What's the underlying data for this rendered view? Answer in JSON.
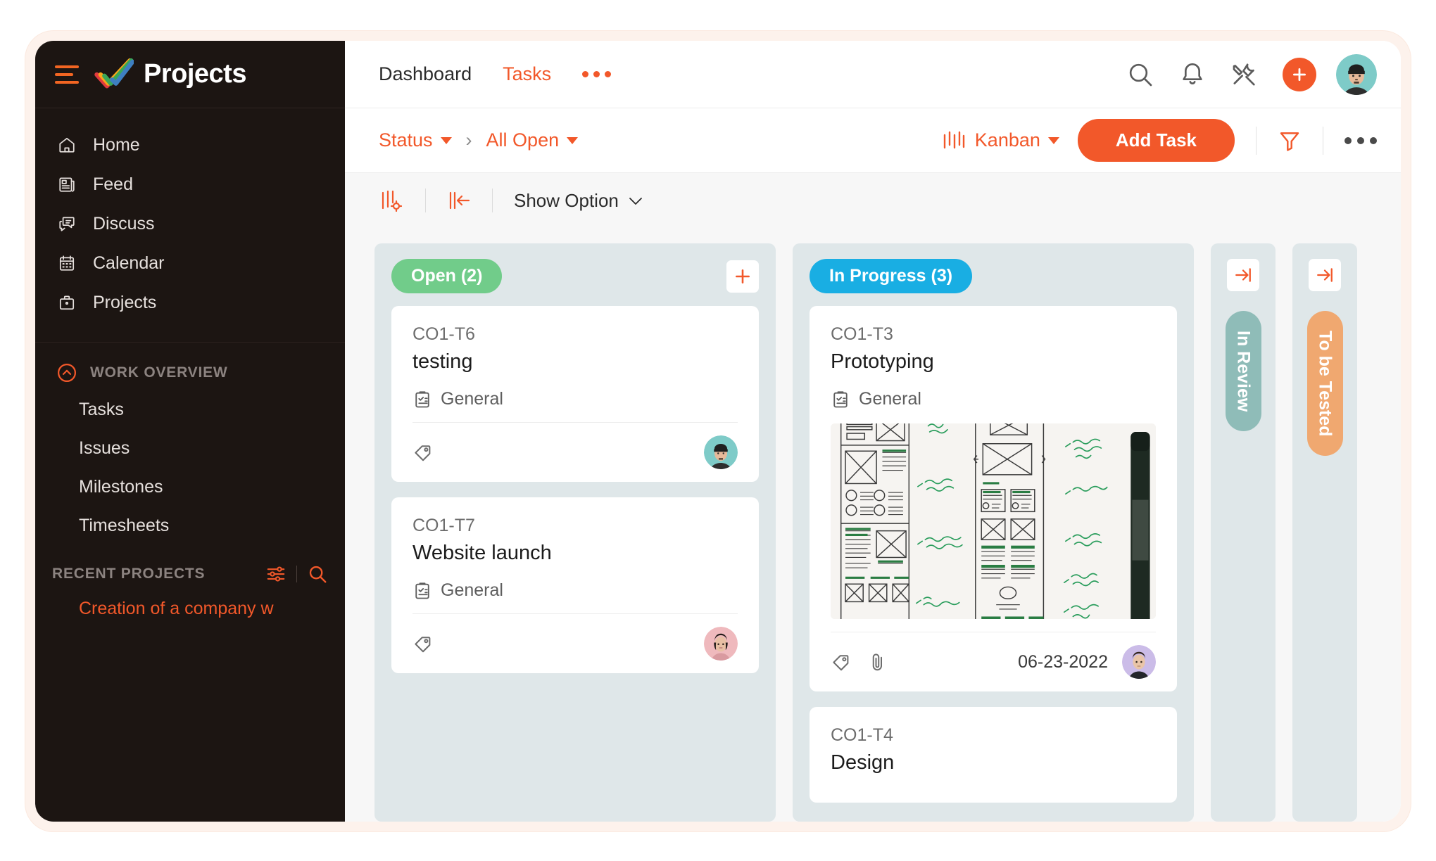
{
  "brand": {
    "title": "Projects",
    "logo_icon": "zoho-projects-logo",
    "menu_icon": "hamburger-icon"
  },
  "sidebar": {
    "nav": [
      {
        "label": "Home",
        "icon": "home-icon"
      },
      {
        "label": "Feed",
        "icon": "feed-icon"
      },
      {
        "label": "Discuss",
        "icon": "discuss-icon"
      },
      {
        "label": "Calendar",
        "icon": "calendar-icon"
      },
      {
        "label": "Projects",
        "icon": "briefcase-icon"
      }
    ],
    "work_overview": {
      "label": "WORK OVERVIEW",
      "collapse_icon": "chevron-up-circle-icon",
      "items": [
        {
          "label": "Tasks"
        },
        {
          "label": "Issues"
        },
        {
          "label": "Milestones"
        },
        {
          "label": "Timesheets"
        }
      ]
    },
    "recent_projects": {
      "label": "RECENT PROJECTS",
      "filter_icon": "sliders-icon",
      "search_icon": "search-icon",
      "items": [
        {
          "label": "Creation of a company w"
        }
      ]
    }
  },
  "topbar": {
    "tabs": [
      {
        "label": "Dashboard",
        "active": false
      },
      {
        "label": "Tasks",
        "active": true
      }
    ],
    "more_icon": "more-horizontal-icon",
    "icons": [
      {
        "name": "search-icon"
      },
      {
        "name": "bell-icon"
      },
      {
        "name": "tools-icon"
      }
    ],
    "add_icon": "plus-icon",
    "avatar": "user-avatar"
  },
  "toolbar": {
    "breadcrumb": [
      {
        "label": "Status",
        "has_caret": true
      },
      {
        "label": "All Open",
        "has_caret": true
      }
    ],
    "separator": "›",
    "view": {
      "label": "Kanban",
      "icon": "kanban-icon",
      "has_caret": true
    },
    "add_task_label": "Add Task",
    "filter_icon": "funnel-icon",
    "more_icon": "more-horizontal-icon"
  },
  "optionbar": {
    "settings_icon": "column-settings-icon",
    "collapse_icon": "collapse-left-icon",
    "show_option_label": "Show Option",
    "show_option_caret": "chevron-down-icon"
  },
  "board": {
    "columns": [
      {
        "title": "Open (2)",
        "color": "#71cc8a",
        "add_icon": "plus-icon",
        "collapsed": false,
        "cards": [
          {
            "key": "CO1-T6",
            "title": "testing",
            "meta_label": "General",
            "meta_icon": "clipboard-check-icon",
            "tag_icon": "tag-icon",
            "has_attachment": false,
            "date": "",
            "avatar": "avatar-teal-beanie",
            "thumbnail": null
          },
          {
            "key": "CO1-T7",
            "title": "Website launch",
            "meta_label": "General",
            "meta_icon": "clipboard-check-icon",
            "tag_icon": "tag-icon",
            "has_attachment": false,
            "date": "",
            "avatar": "avatar-pink-woman",
            "thumbnail": null
          }
        ]
      },
      {
        "title": "In Progress (3)",
        "color": "#19aee3",
        "add_icon": "plus-icon",
        "collapsed": false,
        "cards": [
          {
            "key": "CO1-T3",
            "title": "Prototyping",
            "meta_label": "General",
            "meta_icon": "clipboard-check-icon",
            "tag_icon": "tag-icon",
            "attachment_icon": "paperclip-icon",
            "has_attachment": true,
            "date": "06-23-2022",
            "avatar": "avatar-purple-man",
            "thumbnail": "whiteboard-wireframe-sketch-photo"
          },
          {
            "key": "CO1-T4",
            "title": "Design",
            "meta_label": "",
            "meta_icon": "",
            "tag_icon": "",
            "has_attachment": false,
            "date": "",
            "avatar": "",
            "thumbnail": null
          }
        ]
      }
    ],
    "collapsed_columns": [
      {
        "title": "In Review",
        "color": "#8fbcb8",
        "expand_icon": "expand-right-icon"
      },
      {
        "title": "To be Tested",
        "color": "#f0a870",
        "expand_icon": "expand-right-icon"
      }
    ]
  },
  "colors": {
    "accent": "#f2582a",
    "sidebar_bg": "#1c1512",
    "board_bg": "#f7f7f7",
    "column_bg": "#dfe7e9"
  }
}
